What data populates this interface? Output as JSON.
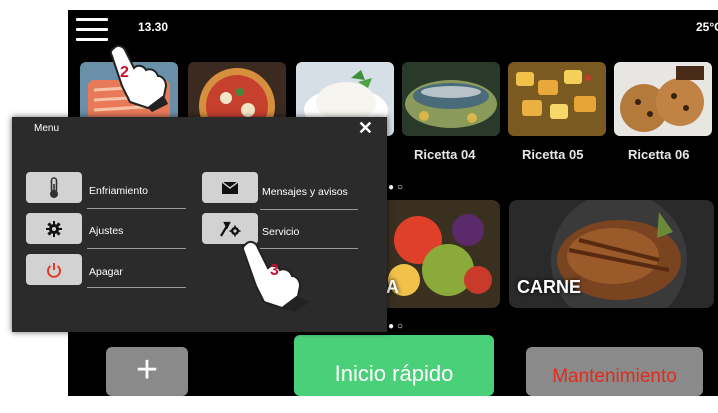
{
  "status": {
    "time": "13.30",
    "temperature": "25°C"
  },
  "recipes": [
    {
      "label": "Ricetta 04"
    },
    {
      "label": "Ricetta 05"
    },
    {
      "label": "Ricetta 06"
    }
  ],
  "categories": [
    {
      "label": "A"
    },
    {
      "label": "CARNE"
    }
  ],
  "bottom": {
    "add_label": "+",
    "start_label": "Inicio rápido",
    "maintenance_label": "Mantenimiento"
  },
  "callouts": {
    "menu": "2",
    "service": "3"
  },
  "menu": {
    "title": "Menu",
    "close": "✕",
    "items": [
      {
        "label": "Enfriamiento",
        "icon": "thermometer-icon"
      },
      {
        "label": "Ajustes",
        "icon": "gear-icon"
      },
      {
        "label": "Apagar",
        "icon": "power-icon"
      },
      {
        "label": "Mensajes y avisos",
        "icon": "envelope-icon"
      },
      {
        "label": "Servicio",
        "icon": "wrench-gear-icon"
      }
    ]
  },
  "colors": {
    "accent_green": "#4bd07a",
    "power_red": "#e03a2a",
    "maintenance_red": "#e22b1a",
    "callout_red": "#c8102e"
  }
}
